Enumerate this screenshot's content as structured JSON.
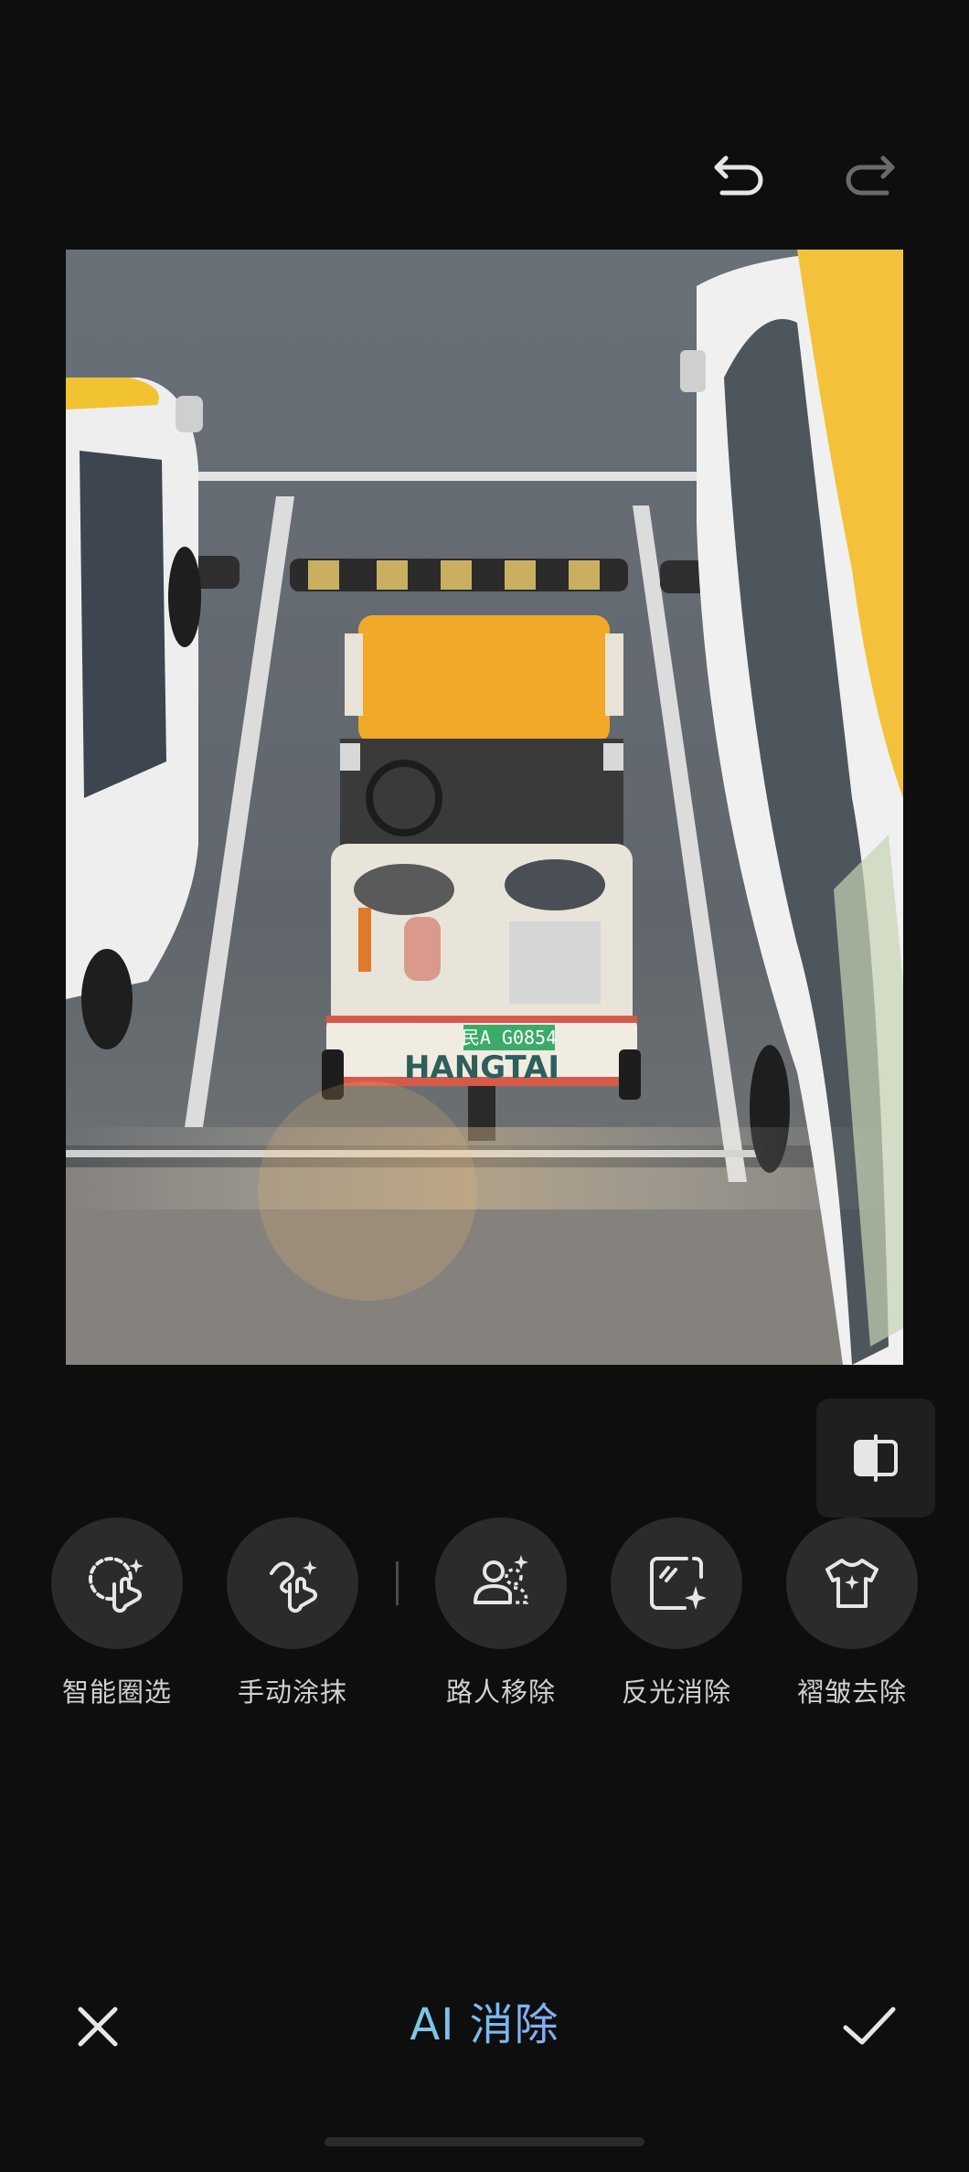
{
  "toolbar": {
    "undo_icon": "undo-icon",
    "redo_icon": "redo-icon"
  },
  "photo": {
    "vehicle_plate": "民A G0854",
    "vehicle_brand": "HANGTAI",
    "description_icon": "photo"
  },
  "compare": {
    "icon": "compare-icon"
  },
  "tools": [
    {
      "label": "智能圈选",
      "icon": "smart-select-icon"
    },
    {
      "label": "手动涂抹",
      "icon": "manual-brush-icon"
    },
    {
      "label": "路人移除",
      "icon": "passerby-remove-icon"
    },
    {
      "label": "反光消除",
      "icon": "reflection-remove-icon"
    },
    {
      "label": "褶皱去除",
      "icon": "wrinkle-remove-icon"
    }
  ],
  "bottom": {
    "title": "AI 消除",
    "cancel_icon": "close-icon",
    "confirm_icon": "check-icon"
  },
  "colors": {
    "background": "#0e0e0e",
    "tool_circle": "#2b2b2b",
    "title_gradient_start": "#7fdcd0",
    "title_gradient_end": "#9a8ff5"
  }
}
